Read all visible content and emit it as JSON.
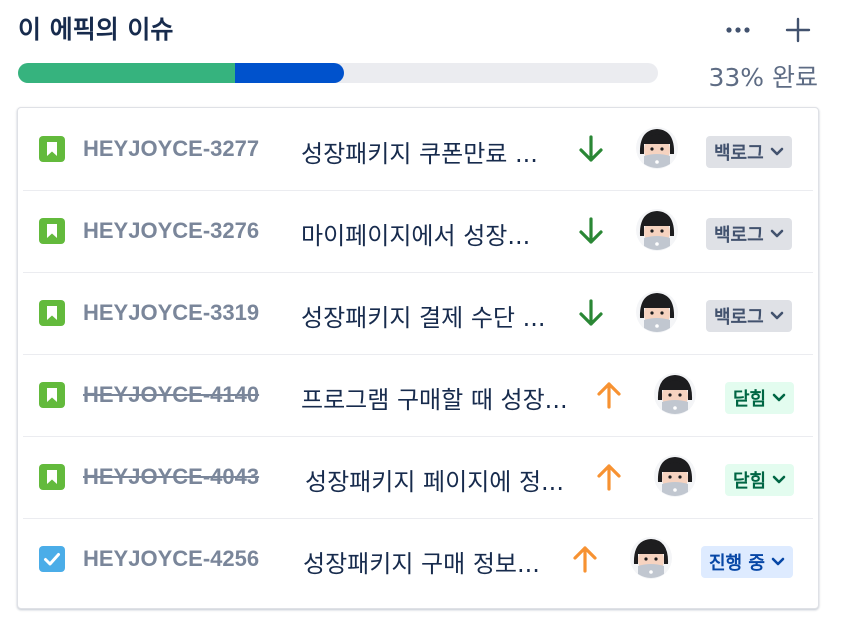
{
  "header": {
    "title": "이 에픽의 이슈",
    "more_icon": "more-horizontal-icon",
    "add_icon": "plus-icon"
  },
  "progress": {
    "done_fraction": 0.339,
    "in_progress_fraction": 0.17,
    "done_color": "#36B37E",
    "in_progress_color": "#0052CC",
    "label": "33% 완료"
  },
  "issues": [
    {
      "key": "HEYJOYCE-3277",
      "summary": "성장패키지 쿠폰만료 ...",
      "type": "story-icon",
      "priority": "low-priority-icon",
      "status": "백로그",
      "status_type": "backlog",
      "done": false
    },
    {
      "key": "HEYJOYCE-3276",
      "summary": "마이페이지에서 성장...",
      "type": "story-icon",
      "priority": "low-priority-icon",
      "status": "백로그",
      "status_type": "backlog",
      "done": false
    },
    {
      "key": "HEYJOYCE-3319",
      "summary": "성장패키지 결제 수단 ...",
      "type": "story-icon",
      "priority": "low-priority-icon",
      "status": "백로그",
      "status_type": "backlog",
      "done": false
    },
    {
      "key": "HEYJOYCE-4140",
      "summary": "프로그램 구매할 때 성장...",
      "type": "story-icon",
      "priority": "high-priority-icon",
      "status": "닫힘",
      "status_type": "closed",
      "done": true
    },
    {
      "key": "HEYJOYCE-4043",
      "summary": "성장패키지 페이지에 정...",
      "type": "story-icon",
      "priority": "high-priority-icon",
      "status": "닫힘",
      "status_type": "closed",
      "done": true
    },
    {
      "key": "HEYJOYCE-4256",
      "summary": "성장패키지 구매 정보...",
      "type": "task-icon",
      "priority": "high-priority-icon",
      "status": "진행 중",
      "status_type": "progress",
      "done": false
    }
  ],
  "colors": {
    "story": "#63BA3C",
    "task": "#4BADE8",
    "low_priority": "#2A8735",
    "high_priority": "#F79232"
  }
}
